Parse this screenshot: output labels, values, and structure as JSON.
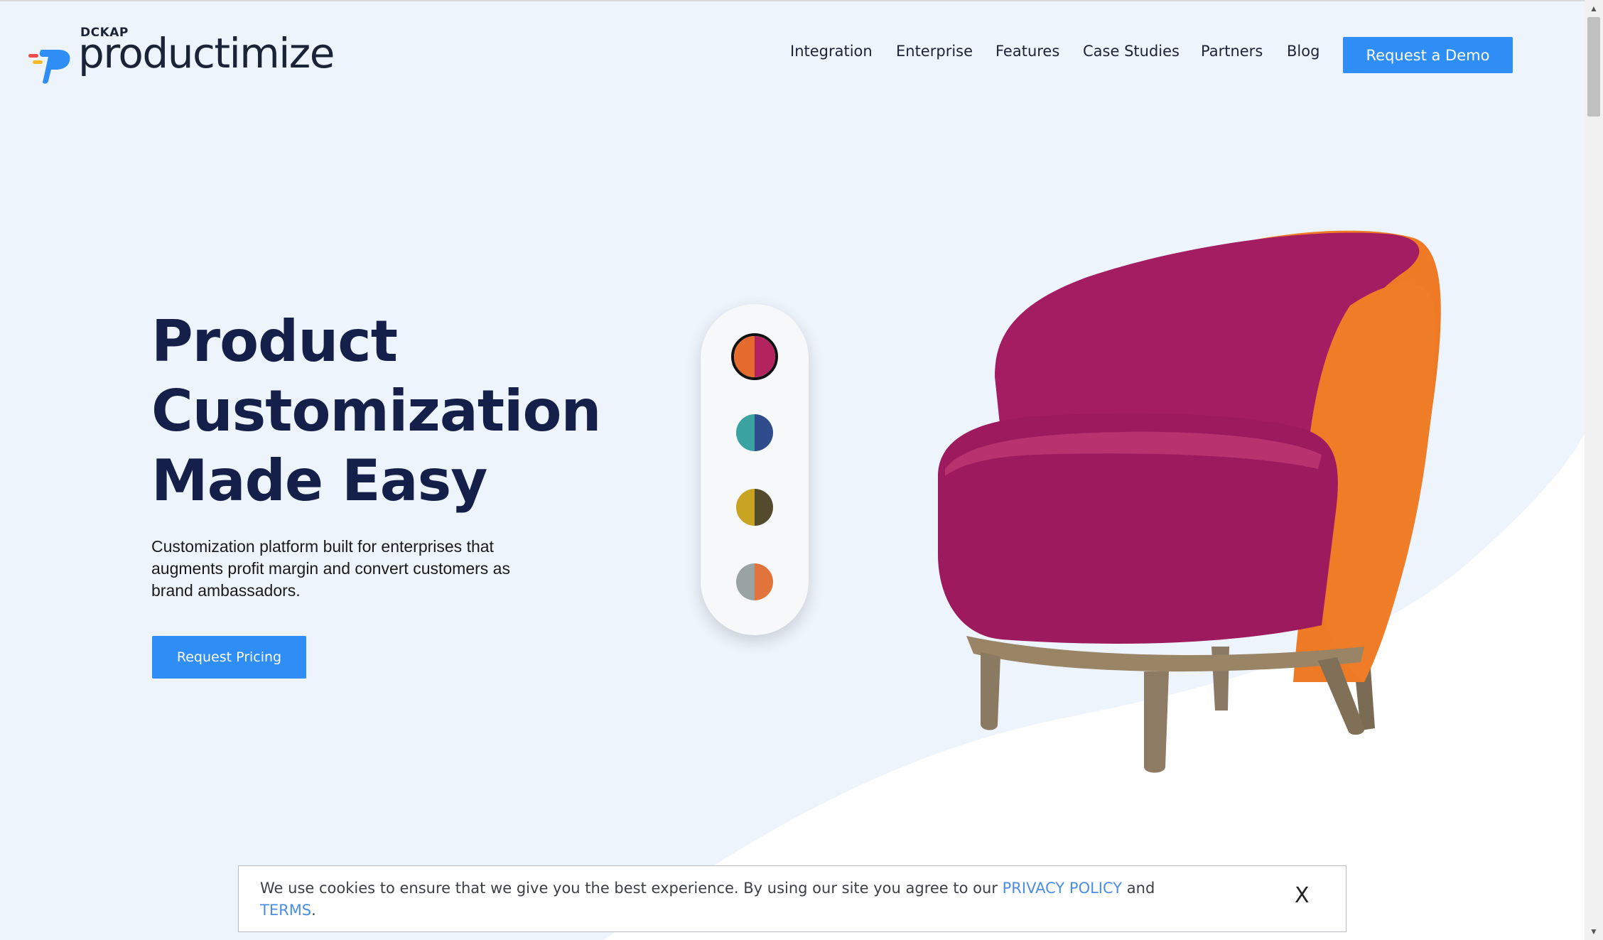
{
  "brand": {
    "company": "DCKAP",
    "product": "productimize"
  },
  "nav": {
    "items": [
      "Integration",
      "Enterprise",
      "Features",
      "Case Studies",
      "Partners",
      "Blog"
    ],
    "cta_label": "Request a Demo"
  },
  "hero": {
    "title_lines": [
      "Product",
      "Customization",
      "Made Easy"
    ],
    "subtitle": "Customization platform built for enterprises that augments profit margin and convert customers as brand ambassadors.",
    "cta_label": "Request Pricing"
  },
  "swatches": [
    {
      "name": "orange-magenta",
      "colors": [
        "#e56a2d",
        "#b3245e"
      ],
      "selected": true
    },
    {
      "name": "teal-blue",
      "colors": [
        "#3aa2a0",
        "#2f4c8c"
      ],
      "selected": false
    },
    {
      "name": "mustard-olive",
      "colors": [
        "#c9a422",
        "#544a2c"
      ],
      "selected": false
    },
    {
      "name": "grey-orange",
      "colors": [
        "#9aa3a3",
        "#e0743a"
      ],
      "selected": false
    }
  ],
  "cookie": {
    "text_before": "We use cookies to ensure that we give you the best experience. By using our site you agree to our ",
    "privacy_link": "PRIVACY POLICY",
    "and_text": " and",
    "terms_link": "TERMS",
    "period": ".",
    "close_label": "X"
  },
  "colors": {
    "accent": "#2e8ef5",
    "heading": "#15204a",
    "chair_primary": "#a41c62",
    "chair_secondary": "#ee7a25"
  }
}
